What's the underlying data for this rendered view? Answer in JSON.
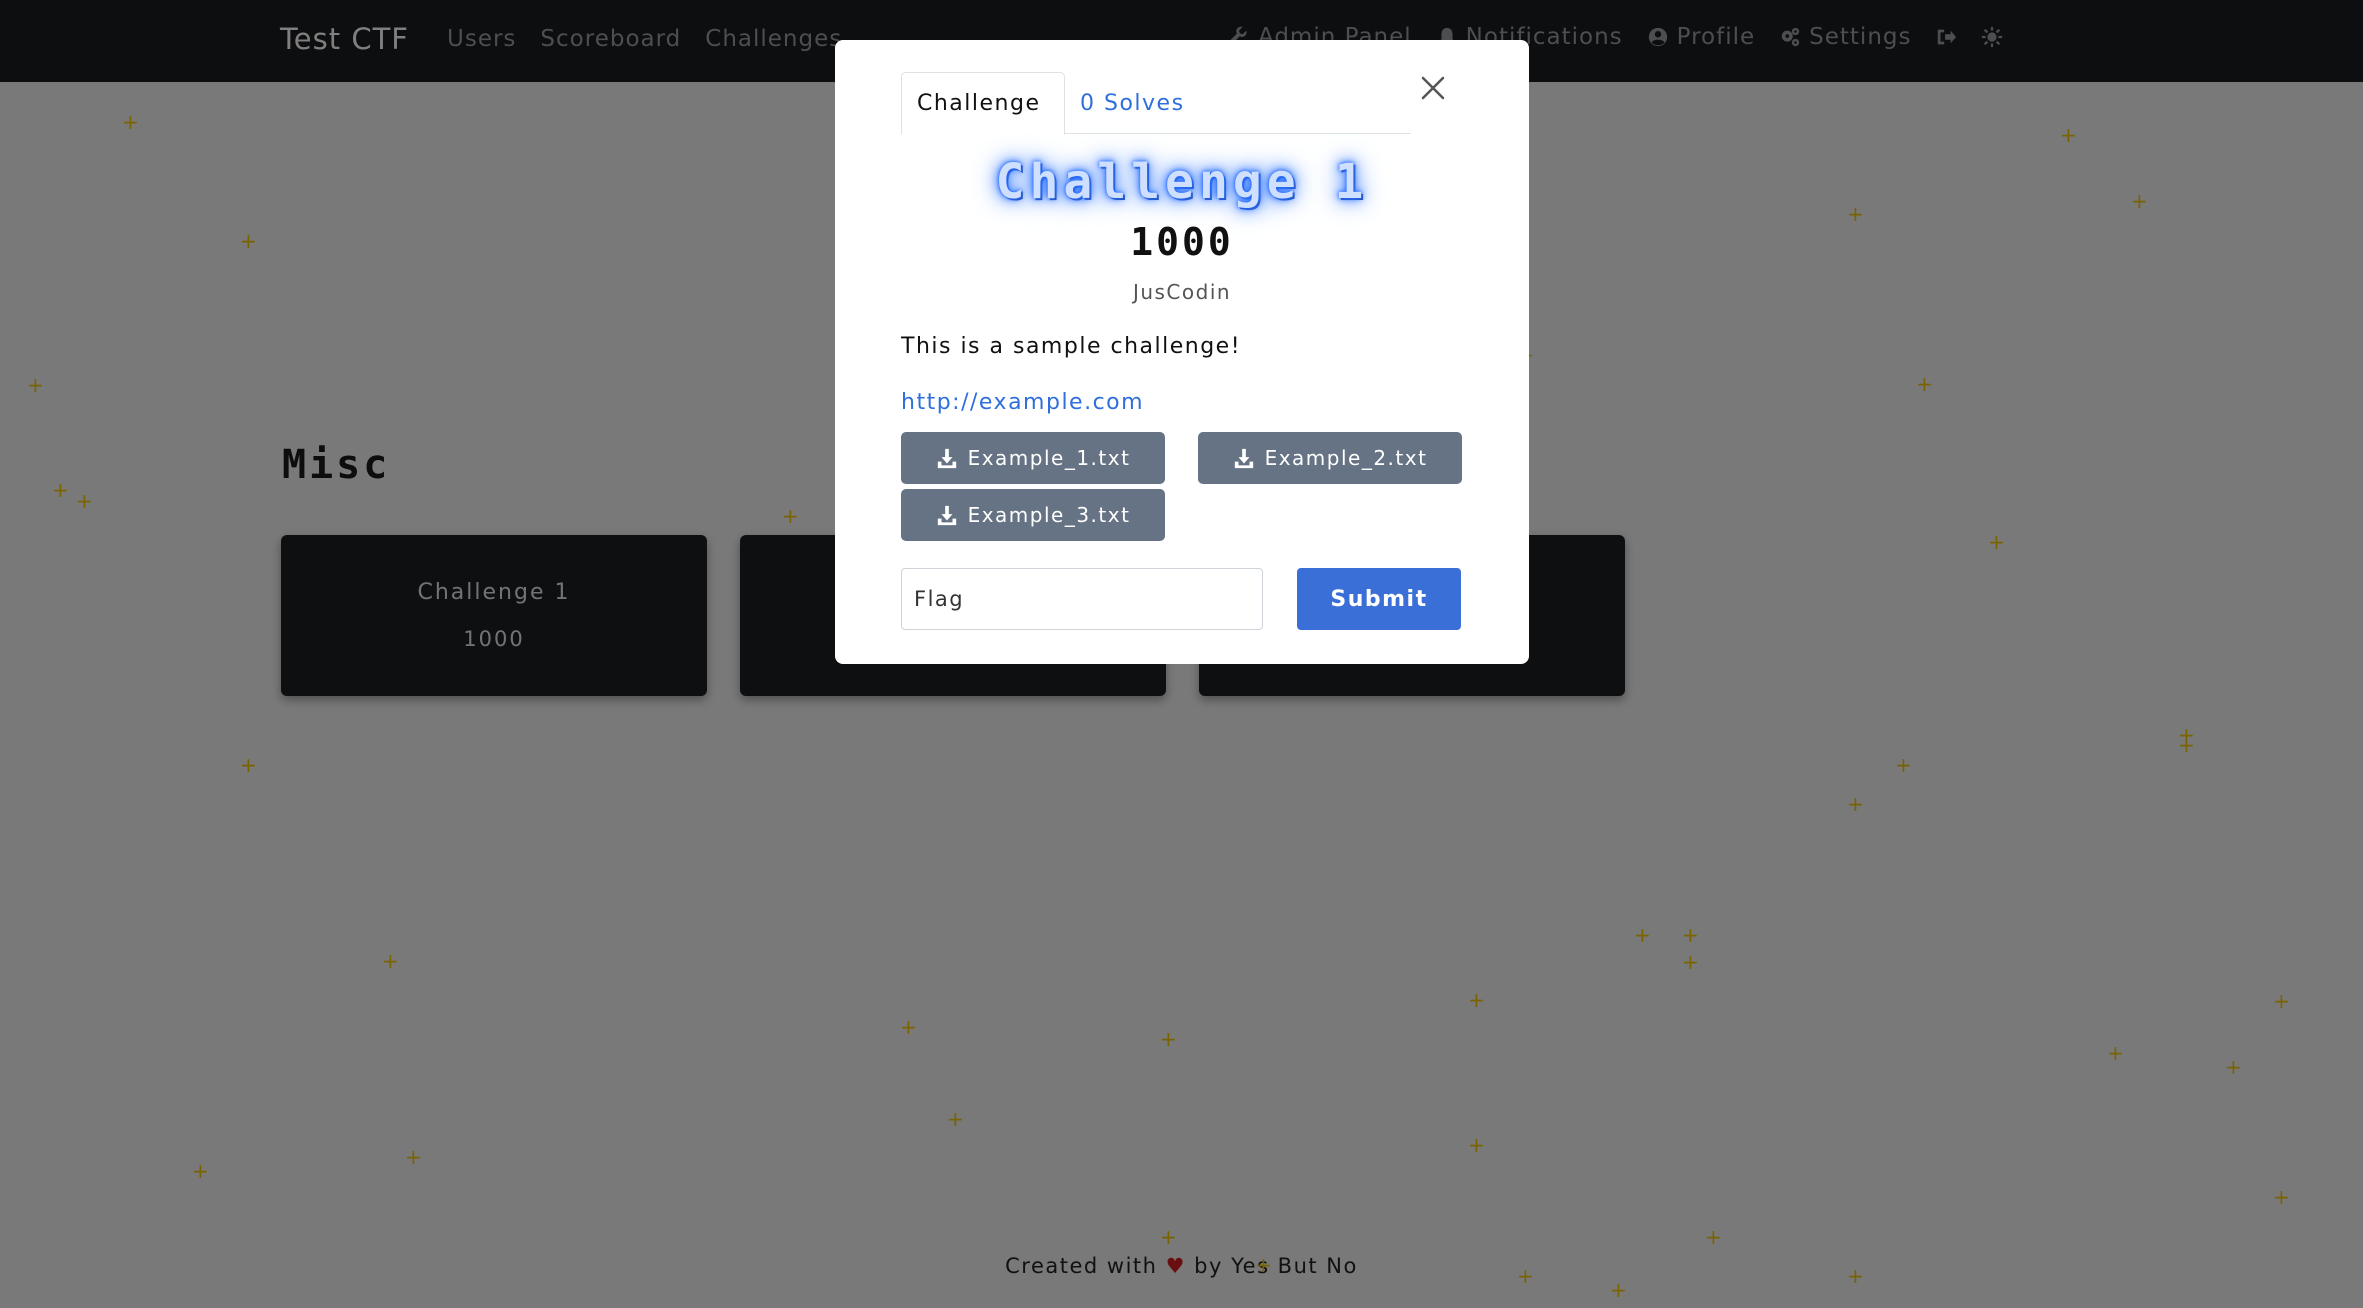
{
  "navbar": {
    "brand": "Test CTF",
    "links": [
      "Users",
      "Scoreboard",
      "Challenges"
    ],
    "right": {
      "admin": "Admin Panel",
      "notifications": "Notifications",
      "profile": "Profile",
      "settings": "Settings"
    }
  },
  "page": {
    "category": "Misc",
    "cards": [
      {
        "name": "Challenge 1",
        "value": "1000"
      },
      {
        "name": "",
        "value": ""
      },
      {
        "name": "",
        "value": ""
      }
    ]
  },
  "footer": {
    "prefix": "Created with",
    "heart": "♥",
    "suffix": "by Yes But No"
  },
  "modal": {
    "tabs": {
      "challenge": "Challenge",
      "solves": "0 Solves"
    },
    "title": "Challenge 1",
    "value": "1000",
    "author": "JusCodin",
    "description": "This is a sample challenge!",
    "link": "http://example.com",
    "files": [
      "Example_1.txt",
      "Example_2.txt",
      "Example_3.txt"
    ],
    "flag_placeholder": "Flag",
    "submit": "Submit"
  },
  "colors": {
    "navbar_bg": "#1b1c1f",
    "card_bg": "#1d1e22",
    "accent": "#3a6fd8",
    "link": "#2f6fdb",
    "file_button": "#667384",
    "sparkle": "#f2c500"
  },
  "icons": [
    "wrench-icon",
    "bell-icon",
    "user-circle-icon",
    "cogs-icon",
    "sign-out-icon",
    "theme-toggle-icon",
    "download-icon",
    "close-icon",
    "sparkle-icon"
  ]
}
